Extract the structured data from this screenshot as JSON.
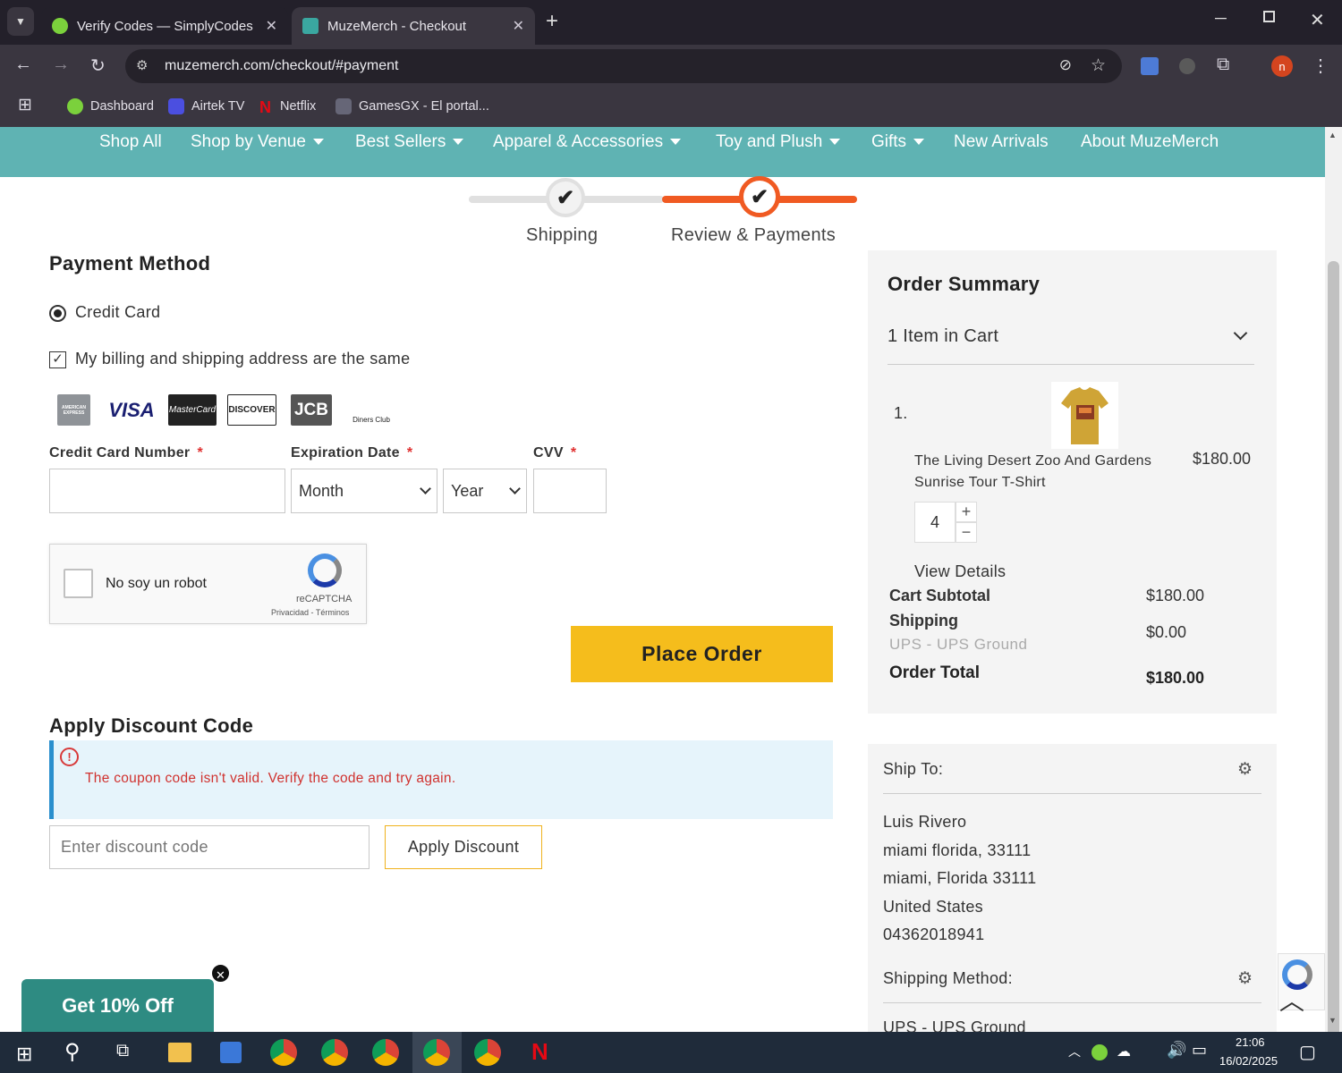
{
  "browser": {
    "tabs": [
      {
        "title": "Verify Codes — SimplyCodes",
        "active": false
      },
      {
        "title": "MuzeMerch - Checkout",
        "active": true
      }
    ],
    "url": "muzemerch.com/checkout/#payment",
    "bookmarks": [
      "Dashboard",
      "Airtek TV",
      "Netflix",
      "GamesGX - El portal..."
    ],
    "profile_initial": "n"
  },
  "nav": {
    "items": [
      "Shop All",
      "Shop by Venue",
      "Best Sellers",
      "Apparel & Accessories",
      "Toy and Plush",
      "Gifts",
      "New Arrivals",
      "About MuzeMerch"
    ]
  },
  "progress": {
    "steps": [
      "Shipping",
      "Review & Payments"
    ],
    "accent": "#f05a22"
  },
  "payment": {
    "title": "Payment Method",
    "method_label": "Credit Card",
    "same_address_label": "My billing and shipping address are the same",
    "cards": [
      "AMERICAN EXPRESS",
      "VISA",
      "MasterCard",
      "DISCOVER",
      "JCB",
      "Diners Club"
    ],
    "cc_number_label": "Credit Card Number",
    "expiration_label": "Expiration Date",
    "cvv_label": "CVV",
    "required_mark": "*",
    "month_value": "Month",
    "year_value": "Year",
    "captcha_label": "No soy un robot",
    "captcha_brand": "reCAPTCHA",
    "captcha_links": "Privacidad - Términos",
    "place_order": "Place Order"
  },
  "discount": {
    "title": "Apply Discount Code",
    "error": "The coupon code isn't valid. Verify the code and try again.",
    "placeholder": "Enter discount code",
    "button": "Apply Discount"
  },
  "summary": {
    "title": "Order Summary",
    "cart_count": "1 Item in Cart",
    "item_index": "1.",
    "item_name_line1": "The Living Desert Zoo And Gardens",
    "item_name_line2": "Sunrise Tour T-Shirt",
    "item_price": "$180.00",
    "qty": "4",
    "view_details": "View Details",
    "subtotal_label": "Cart Subtotal",
    "subtotal_value": "$180.00",
    "shipping_label": "Shipping",
    "shipping_method": "UPS - UPS Ground",
    "shipping_value": "$0.00",
    "total_label": "Order Total",
    "total_value": "$180.00"
  },
  "shipto": {
    "title": "Ship To:",
    "lines": [
      "Luis Rivero",
      "miami florida, 33111",
      "miami, Florida 33111",
      "United States",
      "04362018941"
    ],
    "method_title": "Shipping Method:",
    "method_value": "UPS - UPS Ground"
  },
  "promo": {
    "label": "Get 10% Off"
  },
  "taskbar": {
    "time": "21:06",
    "date": "16/02/2025"
  }
}
